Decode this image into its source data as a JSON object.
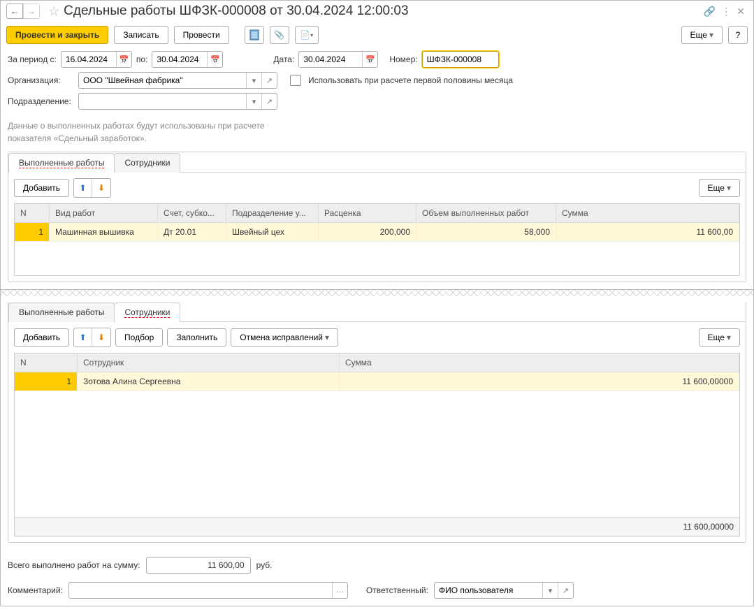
{
  "title": "Сдельные работы ШФЗК-000008 от 30.04.2024 12:00:03",
  "toolbar": {
    "post_close": "Провести и закрыть",
    "write": "Записать",
    "post": "Провести",
    "more": "Еще",
    "help": "?"
  },
  "form": {
    "period_from_lbl": "За период с:",
    "period_from": "16.04.2024",
    "period_to_lbl": "по:",
    "period_to": "30.04.2024",
    "date_lbl": "Дата:",
    "date": "30.04.2024",
    "number_lbl": "Номер:",
    "number": "ШФЗК-000008",
    "org_lbl": "Организация:",
    "org": "ООО \"Швейная фабрика\"",
    "use_half_lbl": "Использовать при расчете первой половины месяца",
    "dept_lbl": "Подразделение:",
    "dept": ""
  },
  "hint_line1": "Данные о выполненных работах будут использованы при расчете",
  "hint_line2": "показателя «Сдельный заработок».",
  "tabs": {
    "works": "Выполненные работы",
    "employees": "Сотрудники"
  },
  "tab_toolbar": {
    "add": "Добавить",
    "pick": "Подбор",
    "fill": "Заполнить",
    "cancel_corr": "Отмена исправлений",
    "more": "Еще"
  },
  "works_cols": {
    "n": "N",
    "type": "Вид работ",
    "account": "Счет, субко...",
    "dept": "Подразделение у...",
    "rate": "Расценка",
    "volume": "Объем выполненных работ",
    "sum": "Сумма"
  },
  "works_row": {
    "n": "1",
    "type": "Машинная вышивка",
    "account": "Дт 20.01",
    "dept": "Швейный цех",
    "rate": "200,000",
    "volume": "58,000",
    "sum": "11 600,00"
  },
  "emp_cols": {
    "n": "N",
    "emp": "Сотрудник",
    "sum": "Сумма"
  },
  "emp_row": {
    "n": "1",
    "emp": "Зотова Алина Сергеевна",
    "sum": "11 600,00000"
  },
  "emp_total": "11 600,00000",
  "bottom": {
    "total_lbl": "Всего выполнено работ на сумму:",
    "total_val": "11 600,00",
    "total_unit": "руб.",
    "comment_lbl": "Комментарий:",
    "resp_lbl": "Ответственный:",
    "resp_val": "ФИО пользователя"
  }
}
